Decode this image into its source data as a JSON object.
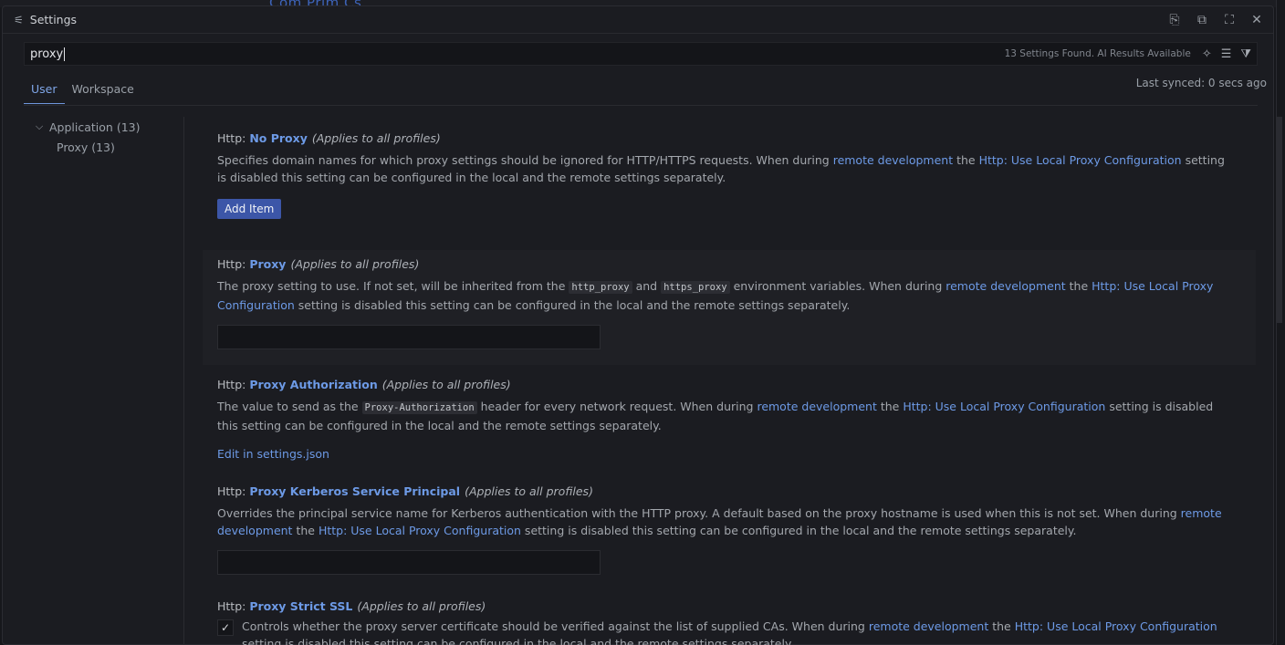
{
  "window": {
    "title": "Settings",
    "bg_text": "Com Prim Cs",
    "actions": [
      "open-json-icon",
      "split-editor-icon",
      "maximize-icon",
      "close-icon"
    ]
  },
  "search": {
    "value": "proxy",
    "results": "13 Settings Found. AI Results Available",
    "icons": [
      "ai-sparkle-icon",
      "clear-filter-icon",
      "filter-icon"
    ]
  },
  "tabs": {
    "user": "User",
    "workspace": "Workspace",
    "synced": "Last synced: 0 secs ago"
  },
  "toc": {
    "group": "Application (13)",
    "item": "Proxy (13)"
  },
  "settings": {
    "no_proxy": {
      "category": "Http: ",
      "key": "No Proxy",
      "scope": "(Applies to all profiles)",
      "desc_a": "Specifies domain names for which proxy settings should be ignored for HTTP/HTTPS requests. When during ",
      "link_remote": "remote development",
      "desc_b": " the ",
      "link_local": "Http: Use Local Proxy Configuration",
      "desc_c": " setting is disabled this setting can be configured in the local and the remote settings separately.",
      "button": "Add Item"
    },
    "proxy": {
      "category": "Http: ",
      "key": "Proxy",
      "scope": "(Applies to all profiles)",
      "desc_a": "The proxy setting to use. If not set, will be inherited from the ",
      "code1": "http_proxy",
      "desc_and": " and ",
      "code2": "https_proxy",
      "desc_b": " environment variables. When during ",
      "link_remote": "remote development",
      "desc_c": " the ",
      "link_local": "Http: Use Local Proxy Configuration",
      "desc_d": " setting is disabled this setting can be configured in the local and the remote settings separately."
    },
    "proxy_auth": {
      "category": "Http: ",
      "key": "Proxy Authorization",
      "scope": "(Applies to all profiles)",
      "desc_a": "The value to send as the ",
      "code": "Proxy-Authorization",
      "desc_b": " header for every network request. When during ",
      "link_remote": "remote development",
      "desc_c": " the ",
      "link_local": "Http: Use Local Proxy Configuration",
      "desc_d": " setting is disabled this setting can be configured in the local and the remote settings separately.",
      "edit": "Edit in settings.json"
    },
    "kerberos": {
      "category": "Http: ",
      "key": "Proxy Kerberos Service Principal",
      "scope": "(Applies to all profiles)",
      "desc_a": "Overrides the principal service name for Kerberos authentication with the HTTP proxy. A default based on the proxy hostname is used when this is not set. When during ",
      "link_remote": "remote development",
      "desc_b": " the ",
      "link_local": "Http: Use Local Proxy Configuration",
      "desc_c": " setting is disabled this setting can be configured in the local and the remote settings separately."
    },
    "strict_ssl": {
      "category": "Http: ",
      "key": "Proxy Strict SSL",
      "scope": "(Applies to all profiles)",
      "checked": true,
      "desc_a": "Controls whether the proxy server certificate should be verified against the list of supplied CAs. When during ",
      "link_remote": "remote development",
      "desc_b": " the ",
      "link_local": "Http: Use Local Proxy Configuration",
      "desc_c": " setting is disabled this setting can be configured in the local and the remote settings separately."
    }
  }
}
